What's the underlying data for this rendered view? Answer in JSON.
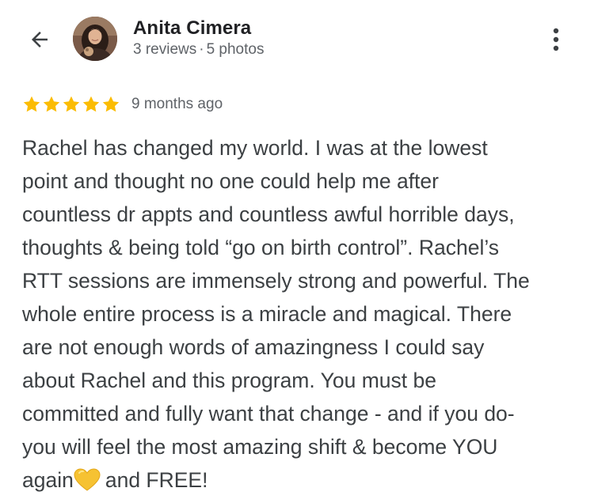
{
  "header": {
    "back_icon": "arrow-back-icon",
    "more_icon": "more-vert-icon",
    "reviewer_name": "Anita Cimera",
    "reviews_count": "3 reviews",
    "separator": "·",
    "photos_count": "5 photos"
  },
  "review": {
    "rating": 5,
    "rating_max": 5,
    "star_color": "#fbbc04",
    "time_ago": "9 months ago",
    "lines": [
      "Rachel has changed my world. I was at the lowest",
      "point and thought no one could help me after",
      "countless dr appts and countless awful horrible days,",
      "thoughts & being told “go on birth control”. Rachel’s",
      "RTT sessions are immensely strong and powerful. The",
      "whole entire process is a miracle and magical. There",
      "are not enough words of amazingness I could say",
      "about Rachel and this program. You must be",
      "committed and fully want that change - and if you do-",
      "you will feel the most amazing shift & become YOU"
    ],
    "last_line_start": "again",
    "emoji_icon": "yellow-heart-icon",
    "last_line_end": "and FREE!"
  }
}
